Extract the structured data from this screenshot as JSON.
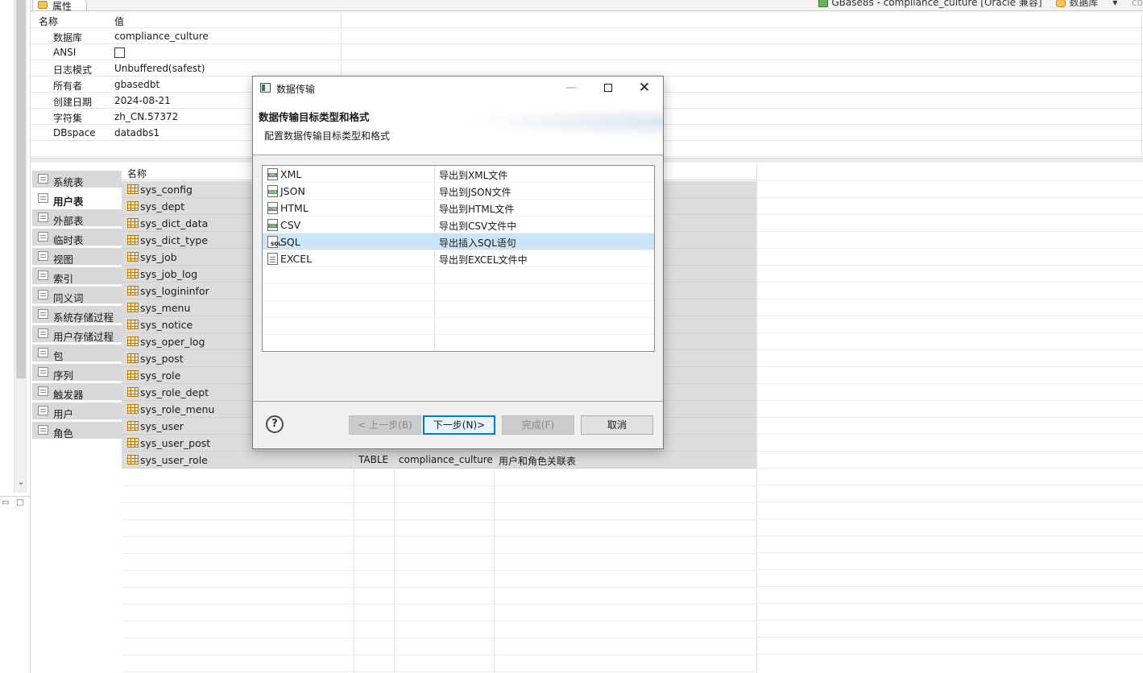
{
  "top_tabs": {
    "properties_tab": "属性",
    "connection": "GBase8s - compliance_culture [Oracle 兼容]",
    "database": "数据库",
    "dropdown_glyph": "▾",
    "extra": "co"
  },
  "properties": {
    "header_name": "名称",
    "header_value": "值",
    "rows": [
      {
        "key": "数据库",
        "value": "compliance_culture"
      },
      {
        "key": "ANSI",
        "value": ""
      },
      {
        "key": "日志模式",
        "value": "Unbuffered(safest)"
      },
      {
        "key": "所有者",
        "value": "gbasedbt"
      },
      {
        "key": "创建日期",
        "value": "2024-08-21"
      },
      {
        "key": "字符集",
        "value": "zh_CN.57372"
      },
      {
        "key": "DBspace",
        "value": "datadbs1"
      }
    ]
  },
  "categories": [
    {
      "label": "系统表",
      "active": false
    },
    {
      "label": "用户表",
      "active": true
    },
    {
      "label": "外部表",
      "active": false
    },
    {
      "label": "临时表",
      "active": false
    },
    {
      "label": "视图",
      "active": false
    },
    {
      "label": "索引",
      "active": false
    },
    {
      "label": "同义词",
      "active": false
    },
    {
      "label": "系统存储过程",
      "active": false
    },
    {
      "label": "用户存储过程",
      "active": false
    },
    {
      "label": "包",
      "active": false
    },
    {
      "label": "序列",
      "active": false
    },
    {
      "label": "触发器",
      "active": false
    },
    {
      "label": "用户",
      "active": false
    },
    {
      "label": "角色",
      "active": false
    }
  ],
  "object_table": {
    "header_name": "名称",
    "rows": [
      {
        "name": "sys_config"
      },
      {
        "name": "sys_dept"
      },
      {
        "name": "sys_dict_data"
      },
      {
        "name": "sys_dict_type"
      },
      {
        "name": "sys_job"
      },
      {
        "name": "sys_job_log"
      },
      {
        "name": "sys_logininfor"
      },
      {
        "name": "sys_menu"
      },
      {
        "name": "sys_notice"
      },
      {
        "name": "sys_oper_log"
      },
      {
        "name": "sys_post"
      },
      {
        "name": "sys_role"
      },
      {
        "name": "sys_role_dept"
      },
      {
        "name": "sys_role_menu"
      },
      {
        "name": "sys_user"
      },
      {
        "name": "sys_user_post"
      },
      {
        "name": "sys_user_role",
        "type": "TABLE",
        "owner": "compliance_culture",
        "comment": "用户和角色关联表"
      }
    ]
  },
  "dialog": {
    "title": "数据传输",
    "heading": "数据传输目标类型和格式",
    "subheading": "配置数据传输目标类型和格式",
    "min_glyph": "—",
    "close_glyph": "✕",
    "help_glyph": "?",
    "formats": [
      {
        "name": "XML",
        "desc": "导出到XML文件",
        "icon_text": "XML",
        "selected": false
      },
      {
        "name": "JSON",
        "desc": "导出到JSON文件",
        "icon_text": "JSON",
        "selected": false
      },
      {
        "name": "HTML",
        "desc": "导出到HTML文件",
        "icon_text": "HTML",
        "selected": false
      },
      {
        "name": "CSV",
        "desc": "导出到CSV文件中",
        "icon_text": "CSV",
        "selected": false
      },
      {
        "name": "SQL",
        "desc": "导出插入SQL语句",
        "icon_text": "SQL",
        "selected": true
      },
      {
        "name": "EXCEL",
        "desc": "导出到EXCEL文件中",
        "icon_text": "",
        "selected": false
      }
    ],
    "buttons": {
      "back": "< 上一步(B)",
      "next": "下一步(N)>",
      "finish": "完成(F)",
      "cancel": "取消"
    }
  }
}
